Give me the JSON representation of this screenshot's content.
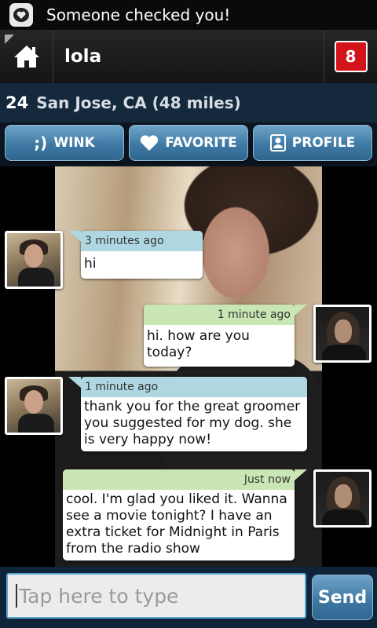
{
  "status_bar": {
    "notification": "Someone checked you!",
    "icon": "app-chat-icon"
  },
  "header": {
    "username": "lola",
    "notification_count": "8",
    "home_icon": "home-icon"
  },
  "profile": {
    "age": "24",
    "location": "San Jose, CA (48 miles)"
  },
  "actions": [
    {
      "label": "WINK",
      "icon_glyph": ";)"
    },
    {
      "label": "FAVORITE",
      "icon_glyph": "heart-icon"
    },
    {
      "label": "PROFILE",
      "icon_glyph": "person-icon"
    }
  ],
  "messages": [
    {
      "direction": "in",
      "time": "3 minutes ago",
      "text": "hi"
    },
    {
      "direction": "out",
      "time": "1 minute ago",
      "text": "hi. how are you today?"
    },
    {
      "direction": "in",
      "time": "1 minute ago",
      "text": "thank you for the great groomer you suggested for my dog. she is very happy now!"
    },
    {
      "direction": "out",
      "time": "Just now",
      "text": "cool. I'm glad you liked it. Wanna see a movie tonight? I have an extra ticket for Midnight in Paris from the radio show"
    }
  ],
  "compose": {
    "placeholder": "Tap here to type",
    "send_label": "Send"
  },
  "colors": {
    "accent_blue": "#3f7aa4",
    "incoming_meta": "#aed7e1",
    "outgoing_meta": "#c9e6b4",
    "badge_red": "#d2131a",
    "info_bar": "#15293d"
  }
}
